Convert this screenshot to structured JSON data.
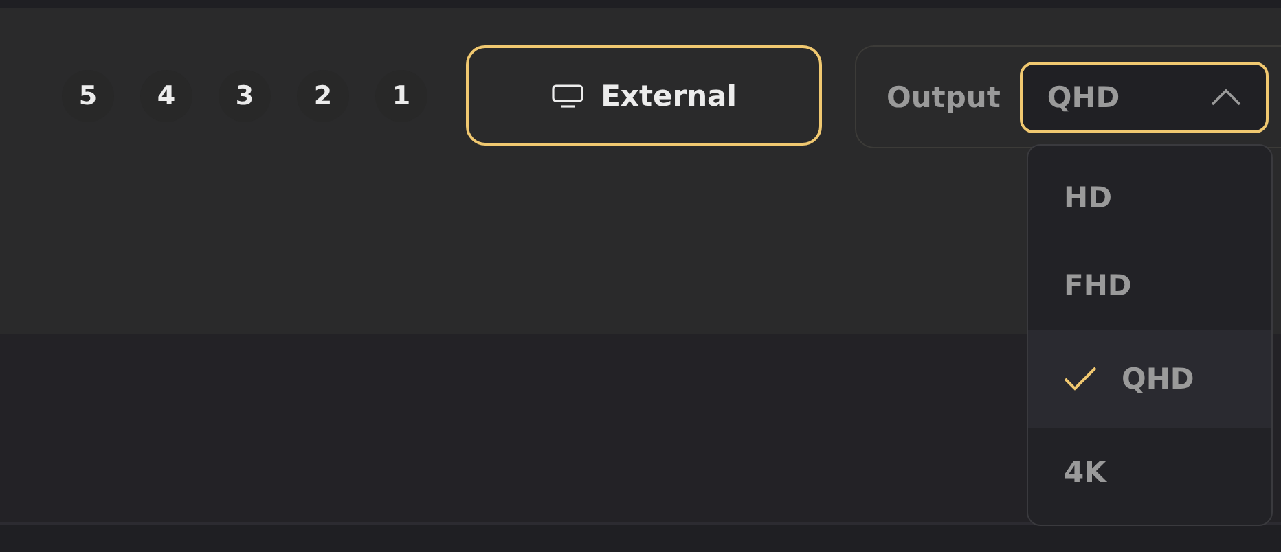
{
  "pages": [
    {
      "label": "5",
      "selected": false
    },
    {
      "label": "4",
      "selected": false
    },
    {
      "label": "3",
      "selected": false
    },
    {
      "label": "2",
      "selected": false
    },
    {
      "label": "1",
      "selected": false
    }
  ],
  "display_button": {
    "label": "External",
    "selected": true
  },
  "output": {
    "label": "Output",
    "value": "QHD",
    "expanded": true,
    "options": [
      {
        "label": "HD",
        "selected": false
      },
      {
        "label": "FHD",
        "selected": false
      },
      {
        "label": "QHD",
        "selected": true
      },
      {
        "label": "4K",
        "selected": false
      }
    ]
  }
}
